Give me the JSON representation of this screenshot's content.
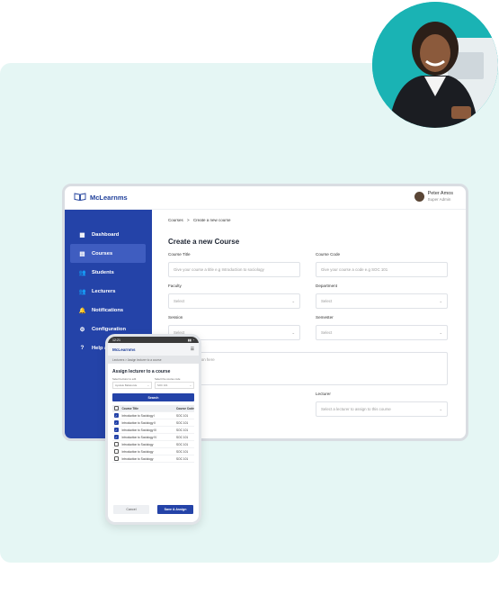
{
  "app": {
    "name": "McLearnms"
  },
  "user": {
    "name": "Peter Amos",
    "role": "Super Admin"
  },
  "sidebar": {
    "items": [
      {
        "label": "Dashboard",
        "icon": "dashboard-icon"
      },
      {
        "label": "Courses",
        "icon": "courses-icon",
        "active": true
      },
      {
        "label": "Students",
        "icon": "students-icon"
      },
      {
        "label": "Lecturers",
        "icon": "lecturers-icon"
      },
      {
        "label": "Notifications",
        "icon": "bell-icon"
      },
      {
        "label": "Configuration",
        "icon": "config-icon"
      },
      {
        "label": "Help an",
        "icon": "help-icon"
      }
    ]
  },
  "breadcrumb": {
    "parent": "Courses",
    "separator": ">",
    "current": "Create a new course"
  },
  "form": {
    "title": "Create a new Course",
    "course_title": {
      "label": "Course Title",
      "placeholder": "Give your course a title e.g Introduction to sociology"
    },
    "course_code": {
      "label": "Course Code",
      "placeholder": "Give your course a code e.g SOC 101"
    },
    "faculty": {
      "label": "Faculty",
      "value": "Select"
    },
    "department": {
      "label": "Department",
      "value": "Select"
    },
    "session": {
      "label": "Session",
      "value": "Select"
    },
    "semester": {
      "label": "Semester",
      "value": "Select"
    },
    "description": {
      "placeholder": "course description here"
    },
    "upload_label": "ge",
    "lecturer": {
      "label": "Lecturer",
      "value": "Select a lecturer to assign to this course"
    }
  },
  "phone": {
    "time": "12:21",
    "app_name": "McLearnms",
    "crumb": "Lecturers > Assign lecturer to a course",
    "title": "Assign lecturer to a course",
    "filter1": {
      "label": "Select lecturer to edit",
      "value": "Ayodele Babatunde"
    },
    "filter2": {
      "label": "Select the course code",
      "value": "SOC 101"
    },
    "search_label": "Search",
    "table": {
      "headers": [
        "Course Title",
        "Course Code"
      ],
      "rows": [
        {
          "title": "Introduction to Sociology I",
          "code": "SOC 101",
          "checked": true
        },
        {
          "title": "Introduction to Sociology II",
          "code": "SOC 101",
          "checked": true
        },
        {
          "title": "Introduction to Sociology III",
          "code": "SOC 101",
          "checked": true
        },
        {
          "title": "Introduction to Sociology IV",
          "code": "SOC 101",
          "checked": true
        },
        {
          "title": "Introduction to Sociology",
          "code": "SOC 101",
          "checked": false
        },
        {
          "title": "Introduction to Sociology",
          "code": "SOC 101",
          "checked": false
        },
        {
          "title": "Introduction to Sociology",
          "code": "SOC 101",
          "checked": false
        }
      ]
    },
    "cancel_label": "Cancel",
    "save_label": "Save & Assign"
  }
}
